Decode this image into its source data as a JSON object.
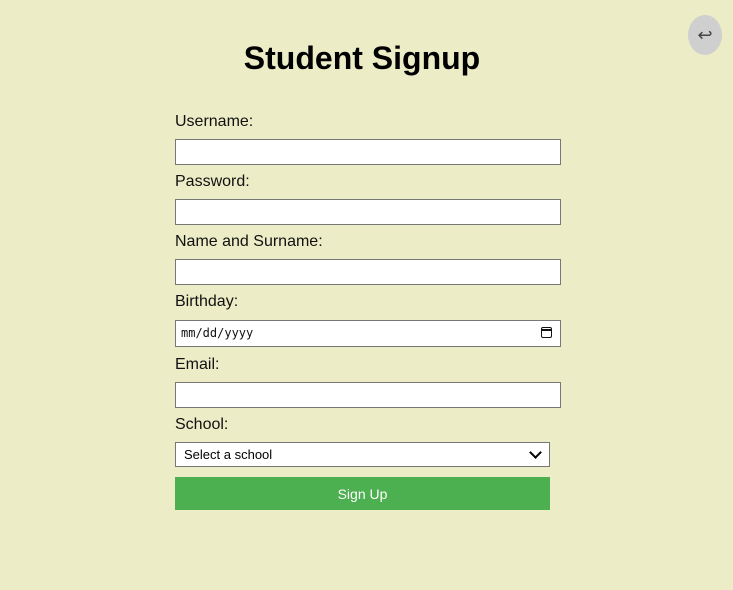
{
  "header": {
    "back_icon": "↩",
    "title": "Student Signup"
  },
  "form": {
    "username": {
      "label": "Username:",
      "value": ""
    },
    "password": {
      "label": "Password:",
      "value": ""
    },
    "name_surname": {
      "label": "Name and Surname:",
      "value": ""
    },
    "birthday": {
      "label": "Birthday:",
      "placeholder": "mm/dd/yyyy"
    },
    "email": {
      "label": "Email:",
      "value": ""
    },
    "school": {
      "label": "School:",
      "selected": "Select a school"
    },
    "submit_label": "Sign Up"
  },
  "colors": {
    "background": "#ececc6",
    "button": "#4caf50",
    "back_button": "#cfcfcf"
  },
  "icons": {
    "back": "return-arrow-icon",
    "calendar": "calendar-icon",
    "select": "chevron-down-icon"
  }
}
